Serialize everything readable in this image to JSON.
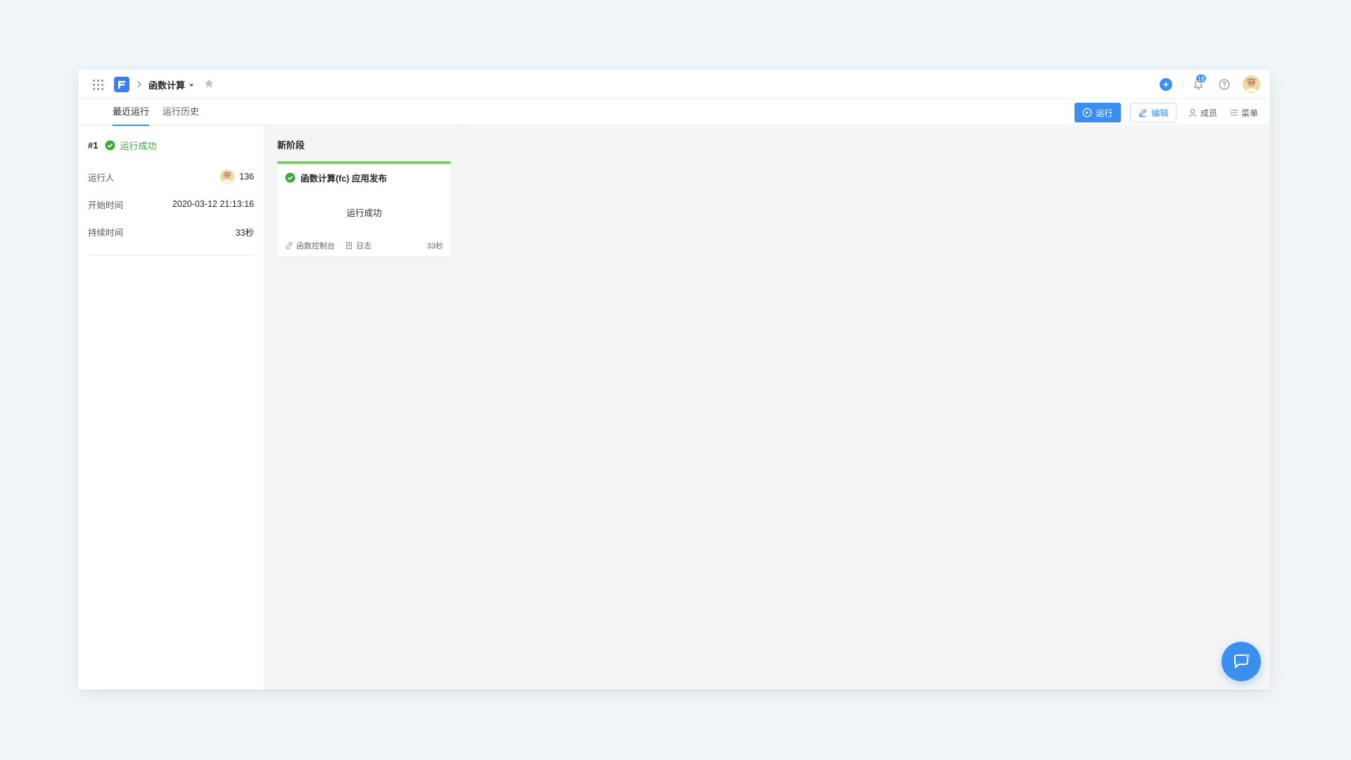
{
  "header": {
    "project_name": "函数计算",
    "notification_count": "18"
  },
  "tabs": [
    {
      "label": "最近运行",
      "active": true
    },
    {
      "label": "运行历史",
      "active": false
    }
  ],
  "actions": {
    "run_label": "运行",
    "edit_label": "编辑",
    "members_label": "成员",
    "menu_label": "菜单"
  },
  "run": {
    "number": "#1",
    "status": "运行成功",
    "rows": [
      {
        "label": "运行人",
        "value": "136"
      },
      {
        "label": "开始时间",
        "value": "2020-03-12 21:13:16"
      },
      {
        "label": "持续时间",
        "value": "33秒"
      }
    ]
  },
  "stage": {
    "title": "新阶段",
    "job": {
      "name": "函数计算(fc) 应用发布",
      "status": "运行成功",
      "console_link": "函数控制台",
      "log_link": "日志",
      "duration": "33秒"
    }
  },
  "colors": {
    "accent": "#3d8fef",
    "success": "#3fa83f",
    "card_top_border": "#7cd06c"
  },
  "icons": [
    "apps-grid-icon",
    "logo-icon",
    "chevron-right-icon",
    "caret-down-icon",
    "star-icon",
    "plus-icon",
    "bell-icon",
    "help-icon",
    "avatar",
    "play-icon",
    "pencil-icon",
    "user-icon",
    "list-icon",
    "check-circle-icon",
    "link-icon",
    "document-icon",
    "chat-icon"
  ]
}
